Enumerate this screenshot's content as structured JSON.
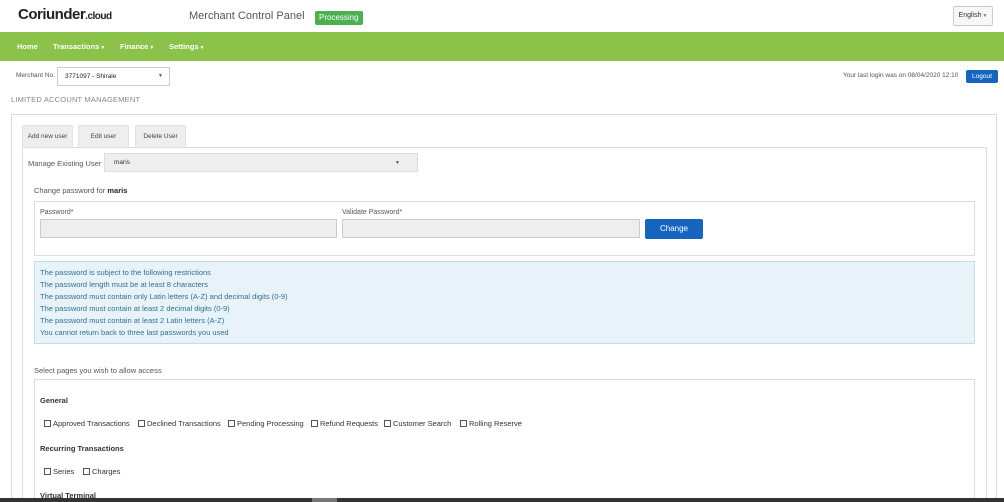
{
  "header": {
    "logo_main": "Coriunder",
    "logo_suffix": ".cloud",
    "panel_title": "Merchant Control Panel",
    "status_badge": "Processing",
    "language": "English"
  },
  "nav": {
    "items": [
      {
        "label": "Home"
      },
      {
        "label": "Transactions"
      },
      {
        "label": "Finance"
      },
      {
        "label": "Settings"
      }
    ]
  },
  "merchant": {
    "label": "Merchant No.",
    "selected": "3771097 - Shirale",
    "last_login_text": "Your last login was on",
    "last_login_value": "08/04/2020 12:10",
    "logout_label": "Logout"
  },
  "page": {
    "section_title": "LIMITED ACCOUNT MANAGEMENT",
    "tabs": [
      {
        "label": "Add new user"
      },
      {
        "label": "Edit user"
      },
      {
        "label": "Delete User"
      }
    ],
    "manage_label": "Manage Existing User",
    "manage_selected": "maris",
    "change_pwd_prefix": "Change password for",
    "change_pwd_user": "maris",
    "password_label": "Password*",
    "validate_label": "Validate Password*",
    "change_button": "Change",
    "restrictions": [
      "The password is subject to the following restrictions",
      "The password length must be at least 8 characters",
      "The password must contain only Latin letters (A-Z) and decimal digits (0-9)",
      "The password must contain at least 2 decimal digits (0-9)",
      "The password must contain at least 2 Latin letters (A-Z)",
      "You cannot return back to three last passwords you used"
    ],
    "select_pages_label": "Select pages you wish to allow access",
    "groups": [
      {
        "title": "General",
        "items": [
          "Approved Transactions",
          "Declined Transactions",
          "Pending Processing",
          "Refund Requests",
          "Customer Search",
          "Rolling Reserve"
        ]
      },
      {
        "title": "Recurring Transactions",
        "items": [
          "Series",
          "Charges"
        ]
      },
      {
        "title": "Virtual Terminal",
        "items": []
      }
    ]
  },
  "icons": {
    "caret": "chevron-down-icon",
    "checkbox": "checkbox-icon"
  },
  "colors": {
    "nav": "#8bc34a",
    "badge": "#4caf50",
    "button": "#1565c0",
    "info_bg": "#e7f3f8",
    "info_text": "#31708f"
  }
}
